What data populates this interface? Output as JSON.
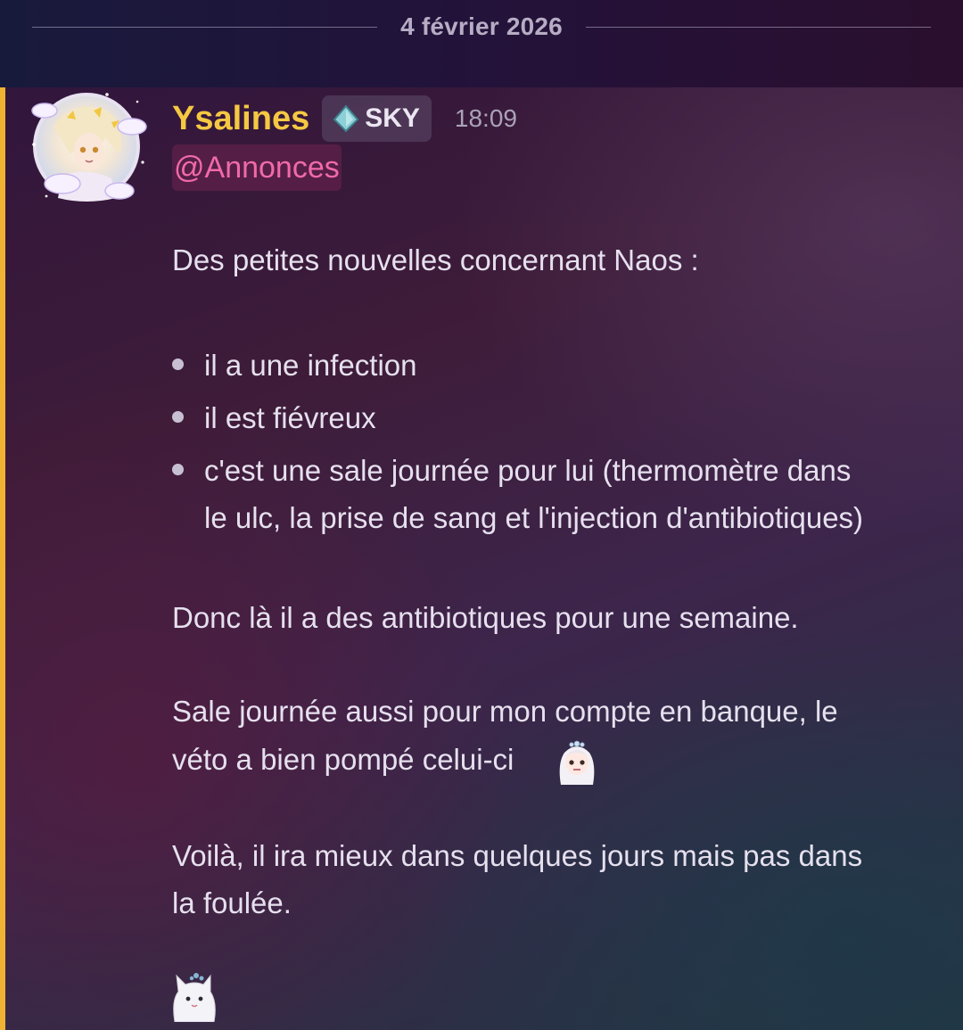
{
  "divider": {
    "date": "4 février 2026"
  },
  "message": {
    "author": "Ysalines",
    "tag": {
      "icon": "water-drop-icon",
      "label": "SKY"
    },
    "timestamp": "18:09",
    "mention": "@Annonces",
    "intro": "Des petites nouvelles concernant Naos :",
    "bullets": [
      "il a une infection",
      "il est fiévreux",
      "c'est une sale journée pour lui (thermomètre dans",
      "le ulc, la prise de sang et l'injection d'antibiotiques)"
    ],
    "paragraph_1": "Donc là il a des antibiotiques pour une semaine.",
    "paragraph_2_line_1": "Sale journée aussi pour mon compte en banque, le",
    "paragraph_2_line_2": "véto a bien pompé celui-ci",
    "paragraph_3_line_1": "Voilà, il ira mieux dans quelques jours mais pas dans",
    "paragraph_3_line_2": "la foulée.",
    "emojis": [
      "custom-emoji-anime-face",
      "custom-emoji-white-cat"
    ]
  },
  "colors": {
    "author": "#f5c842",
    "mention": "#f06aa8",
    "highlight_bar": "#f0b232"
  }
}
